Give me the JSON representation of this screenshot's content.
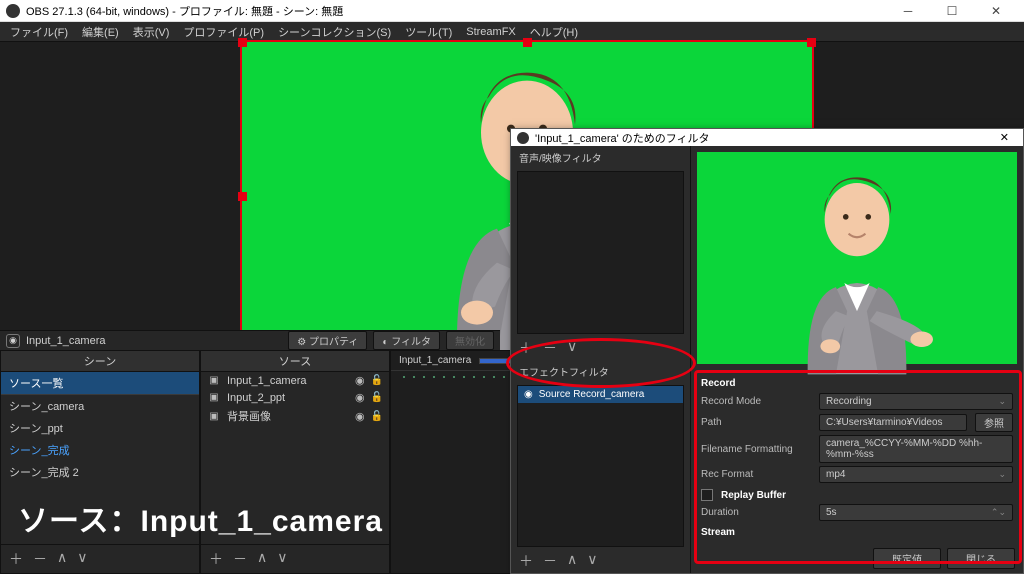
{
  "window": {
    "title": "OBS 27.1.3 (64-bit, windows) - プロファイル: 無題 - シーン: 無題",
    "min": "─",
    "max": "☐",
    "close": "✕"
  },
  "menu": {
    "file": "ファイル(F)",
    "edit": "編集(E)",
    "view": "表示(V)",
    "profile": "プロファイル(P)",
    "scene_col": "シーンコレクション(S)",
    "tools": "ツール(T)",
    "streamfx": "StreamFX",
    "help": "ヘルプ(H)"
  },
  "controls": {
    "current_src": "Input_1_camera",
    "properties": "プロパティ",
    "filters": "フィルタ",
    "disable": "無効化"
  },
  "panels": {
    "scenes": "シーン",
    "sources": "ソース"
  },
  "scenes": {
    "items": [
      {
        "label": "ソース一覧"
      },
      {
        "label": "シーン_camera"
      },
      {
        "label": "シーン_ppt"
      },
      {
        "label": "シーン_完成"
      },
      {
        "label": "シーン_完成 2"
      }
    ]
  },
  "sources": {
    "items": [
      {
        "name": "Input_1_camera",
        "icon": "▣"
      },
      {
        "name": "Input_2_ppt",
        "icon": "▣"
      },
      {
        "name": "背景画像",
        "icon": "▣"
      }
    ]
  },
  "timeline": {
    "track": "Input_1_camera"
  },
  "footer": {
    "plus": "＋",
    "minus": "－",
    "up": "∧",
    "down": "∨"
  },
  "filters_window": {
    "title": "'Input_1_camera' のためのフィルタ",
    "av_label": "音声/映像フィルタ",
    "fx_label": "エフェクトフィルタ",
    "effect_item": "Source Record_camera",
    "record": {
      "group": "Record",
      "mode_label": "Record Mode",
      "mode_val": "Recording",
      "path_label": "Path",
      "path_val": "C:¥Users¥tarmino¥Videos",
      "browse": "参照",
      "fmt_label": "Filename Formatting",
      "fmt_val": "camera_%CCYY-%MM-%DD %hh-%mm-%ss",
      "recfmt_label": "Rec Format",
      "recfmt_val": "mp4",
      "replay_label": "Replay Buffer",
      "dur_label": "Duration",
      "dur_val": "5s",
      "stream_group": "Stream"
    },
    "defaults": "既定値",
    "close": "閉じる"
  },
  "caption": "ソース：Input_1_camera"
}
